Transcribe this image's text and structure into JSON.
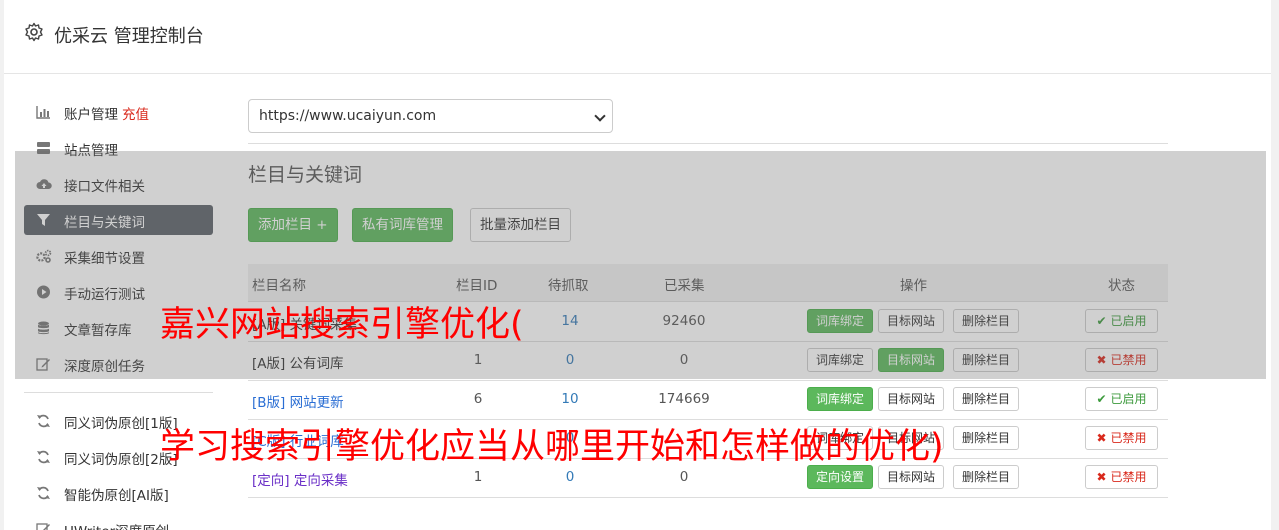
{
  "header": {
    "title": "优采云 管理控制台"
  },
  "sidebar": {
    "items": [
      {
        "label": "账户管理",
        "badge": "充值",
        "icon": "bar-chart-icon"
      },
      {
        "label": "站点管理",
        "icon": "server-icon"
      },
      {
        "label": "接口文件相关",
        "icon": "cloud-upload-icon"
      },
      {
        "label": "栏目与关键词",
        "icon": "filter-icon"
      },
      {
        "label": "采集细节设置",
        "icon": "gears-icon"
      },
      {
        "label": "手动运行测试",
        "icon": "play-circle-icon"
      },
      {
        "label": "文章暂存库",
        "icon": "database-icon"
      },
      {
        "label": "深度原创任务",
        "icon": "edit-icon"
      }
    ],
    "tools": [
      {
        "label": "同义词伪原创[1版]",
        "icon": "refresh-icon"
      },
      {
        "label": "同义词伪原创[2版]",
        "icon": "refresh-icon"
      },
      {
        "label": "智能伪原创[AI版]",
        "icon": "refresh-icon"
      },
      {
        "label": "UWriter深度原创",
        "icon": "edit-icon"
      }
    ]
  },
  "main": {
    "site_select": "https://www.ucaiyun.com",
    "section_title": "栏目与关键词",
    "buttons": {
      "add": "添加栏目 +",
      "private_lib": "私有词库管理",
      "batch_add": "批量添加栏目"
    },
    "table": {
      "headers": [
        "栏目名称",
        "栏目ID",
        "待抓取",
        "已采集",
        "操作",
        "状态"
      ],
      "rows": [
        {
          "name": "[A版] 关键词采集",
          "id": "",
          "pending": "14",
          "collected": "92460",
          "status": "已启用"
        },
        {
          "name": "[A版] 公有词库",
          "id": "1",
          "pending": "0",
          "collected": "0",
          "status": "已禁用"
        },
        {
          "name": "[B版] 网站更新",
          "id": "6",
          "pending": "10",
          "collected": "174669",
          "status": "已启用"
        },
        {
          "name": "[C版] 行业词库",
          "id": "",
          "pending": "0",
          "collected": "",
          "status": "已禁用"
        },
        {
          "name": "[定向] 定向采集",
          "id": "1",
          "pending": "0",
          "collected": "0",
          "status": "已禁用"
        }
      ],
      "actions": {
        "bind": "词库绑定",
        "target": "目标网站",
        "delete": "删除栏目",
        "directed": "定向设置"
      }
    }
  },
  "overlay": {
    "line1": "嘉兴网站搜索引擎优化(",
    "line2": "学习搜索引擎优化应当从哪里开始和怎样做的优化)"
  },
  "colors": {
    "accent_green": "#5cb85c",
    "active_sidebar": "#5b6068",
    "overlay_text": "#ff0000"
  }
}
